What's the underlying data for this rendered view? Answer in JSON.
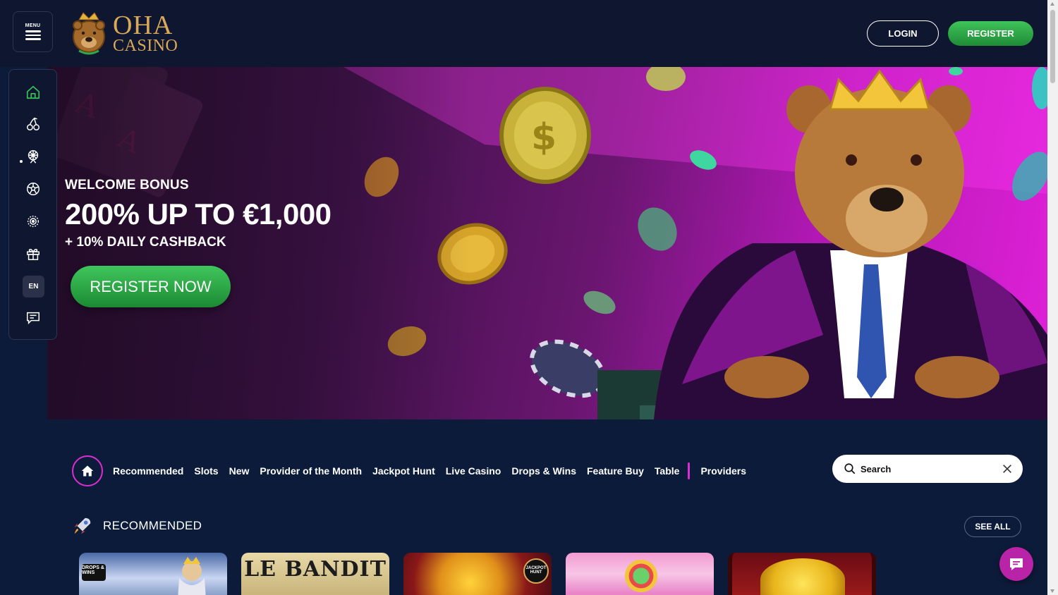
{
  "header": {
    "menu_label": "MENU",
    "logo_line1": "OHA",
    "logo_line2": "CASINO",
    "login_label": "LOGIN",
    "register_label": "REGISTER"
  },
  "sidenav": {
    "items": [
      {
        "icon": "home-icon",
        "active": true
      },
      {
        "icon": "cherry-icon"
      },
      {
        "icon": "ferris-wheel-icon"
      },
      {
        "icon": "soccer-ball-icon"
      },
      {
        "icon": "target-icon"
      },
      {
        "icon": "gift-icon"
      },
      {
        "icon": "language-button"
      },
      {
        "icon": "support-chat-icon"
      }
    ],
    "language": "EN"
  },
  "hero": {
    "eyebrow": "WELCOME BONUS",
    "title": "200% UP TO €1,000",
    "subtitle": "+ 10% DAILY CASHBACK",
    "cta_label": "REGISTER NOW"
  },
  "categories": {
    "items": [
      "Recommended",
      "Slots",
      "New",
      "Provider of the Month",
      "Jackpot Hunt",
      "Live Casino",
      "Drops & Wins",
      "Feature Buy",
      "Table"
    ],
    "providers_label": "Providers"
  },
  "search": {
    "placeholder": "Search"
  },
  "recommended": {
    "title": "RECOMMENDED",
    "see_all_label": "SEE ALL",
    "tiles": [
      {
        "name": "",
        "badge": "DROPS & WINS"
      },
      {
        "name": "LE BANDIT"
      },
      {
        "name": "",
        "badge": "JACKPOT HUNT"
      },
      {
        "name": ""
      },
      {
        "name": ""
      }
    ]
  },
  "colors": {
    "background": "#0d1b3a",
    "header": "#0f1630",
    "accent_green": "#2fa84a",
    "accent_magenta": "#d92ed0",
    "chat_button": "#b823a8",
    "logo_gold": "#d9a95a"
  }
}
